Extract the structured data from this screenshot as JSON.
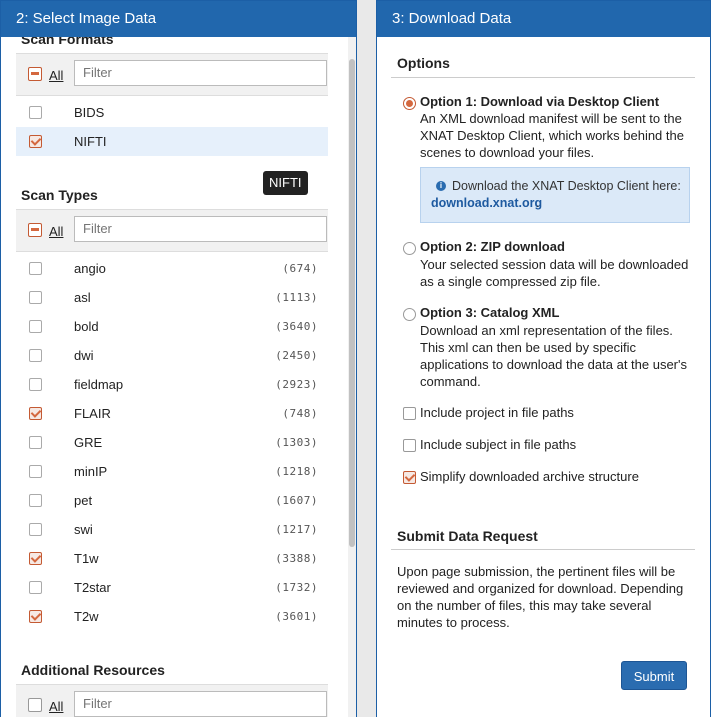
{
  "left_panel": {
    "title": "2: Select Image Data",
    "scan_formats": {
      "title": "Scan Formats",
      "all_label": "All",
      "filter_placeholder": "Filter",
      "items": [
        {
          "name": "BIDS",
          "checked": false
        },
        {
          "name": "NIFTI",
          "checked": true
        }
      ],
      "tooltip": "NIFTI"
    },
    "scan_types": {
      "title": "Scan Types",
      "all_label": "All",
      "filter_placeholder": "Filter",
      "items": [
        {
          "name": "angio",
          "count": "(674)",
          "checked": false
        },
        {
          "name": "asl",
          "count": "(1113)",
          "checked": false
        },
        {
          "name": "bold",
          "count": "(3640)",
          "checked": false
        },
        {
          "name": "dwi",
          "count": "(2450)",
          "checked": false
        },
        {
          "name": "fieldmap",
          "count": "(2923)",
          "checked": false
        },
        {
          "name": "FLAIR",
          "count": "(748)",
          "checked": true
        },
        {
          "name": "GRE",
          "count": "(1303)",
          "checked": false
        },
        {
          "name": "minIP",
          "count": "(1218)",
          "checked": false
        },
        {
          "name": "pet",
          "count": "(1607)",
          "checked": false
        },
        {
          "name": "swi",
          "count": "(1217)",
          "checked": false
        },
        {
          "name": "T1w",
          "count": "(3388)",
          "checked": true
        },
        {
          "name": "T2star",
          "count": "(1732)",
          "checked": false
        },
        {
          "name": "T2w",
          "count": "(3601)",
          "checked": true
        }
      ]
    },
    "additional_resources": {
      "title": "Additional Resources",
      "all_label": "All",
      "filter_placeholder": "Filter"
    }
  },
  "right_panel": {
    "title": "3: Download Data",
    "options_title": "Options",
    "option1": {
      "title": "Option 1: Download via Desktop Client",
      "desc": "An XML download manifest will be sent to the XNAT Desktop Client, which works behind the scenes to download your files.",
      "info_text": "Download the XNAT Desktop Client here:",
      "info_link": "download.xnat.org",
      "info_suffix": ".",
      "selected": true
    },
    "option2": {
      "title": "Option 2: ZIP download",
      "desc": "Your selected session data will be downloaded as a single compressed zip file.",
      "selected": false
    },
    "option3": {
      "title": "Option 3: Catalog XML",
      "desc": "Download an xml representation of the files. This xml can then be used by specific applications to download the data at the user's command.",
      "selected": false
    },
    "checkboxes": [
      {
        "label": "Include project in file paths",
        "checked": false
      },
      {
        "label": "Include subject in file paths",
        "checked": false
      },
      {
        "label": "Simplify downloaded archive structure",
        "checked": true
      }
    ],
    "submit_title": "Submit Data Request",
    "submit_text": "Upon page submission, the pertinent files will be reviewed and organized for download. Depending on the number of files, this may take several minutes to process.",
    "submit_label": "Submit"
  },
  "colors": {
    "header": "#2167ad",
    "accent": "#d4683f",
    "button": "#2a6cb0"
  }
}
